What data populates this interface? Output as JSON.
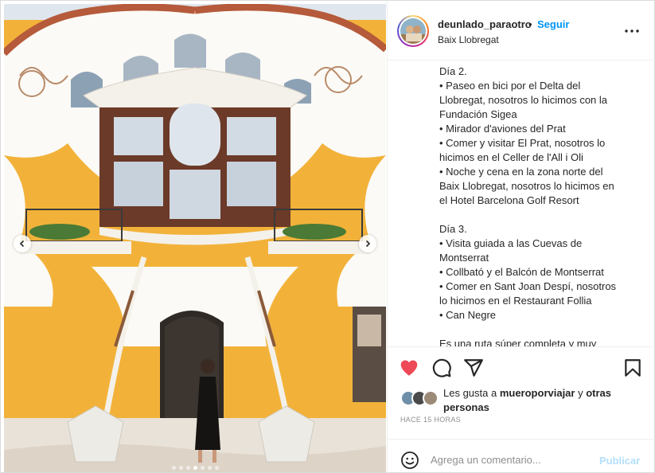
{
  "post": {
    "username": "deunlado_paraotro",
    "separator": "•",
    "follow_label": "Seguir",
    "location": "Baix Llobregat",
    "more_icon": "more-options-icon",
    "caption_lines": [
      "Día 2.",
      "• Paseo en bici por el Delta del",
      "Llobregat, nosotros lo hicimos con la",
      "Fundación Sigea",
      "• Mirador d'aviones del Prat",
      "• Comer y visitar El Prat, nosotros lo",
      "hicimos en el Celler de l'All i Oli",
      "• Noche y cena en la zona norte del",
      "Baix Llobregat, nosotros lo hicimos en",
      "el Hotel Barcelona Golf Resort",
      "",
      "Día 3.",
      "• Visita guiada a las Cuevas de",
      "Montserrat",
      "• Collbató y el Balcón de Montserrat",
      "• Comer en Sant Joan Despí, nosotros",
      "lo hicimos en el Restaurant Follia",
      "• Can Negre",
      "",
      "Es una ruta súper completa y muy"
    ],
    "likes": {
      "prefix": "Les gusta a ",
      "user": "mueroporviajar",
      "middle": " y ",
      "others": "otras personas"
    },
    "timestamp": "HACE 15 HORAS",
    "comment_placeholder": "Agrega un comentario...",
    "publish_label": "Publicar"
  },
  "carousel": {
    "slide_count": 7,
    "active_index": 3
  },
  "colors": {
    "accent": "#0095f6",
    "like": "#ed4956",
    "publish_disabled": "#b2dffc",
    "facade_yellow": "#f2b23a"
  },
  "icons": [
    "heart-icon",
    "comment-icon",
    "share-icon",
    "bookmark-icon",
    "emoji-icon",
    "chevron-left-icon",
    "chevron-right-icon"
  ]
}
